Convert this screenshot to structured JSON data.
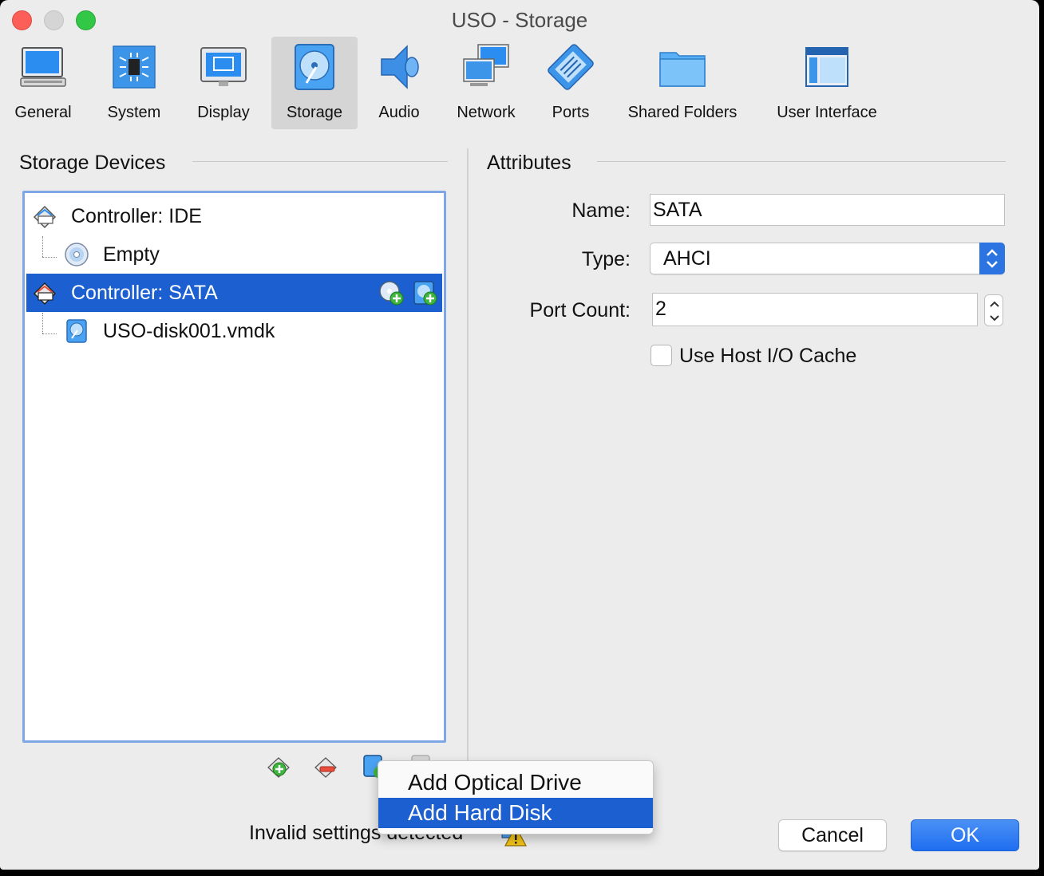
{
  "window": {
    "title": "USO - Storage"
  },
  "toolbar": {
    "items": [
      {
        "label": "General",
        "icon": "general-monitor-icon"
      },
      {
        "label": "System",
        "icon": "chip-icon"
      },
      {
        "label": "Display",
        "icon": "display-icon"
      },
      {
        "label": "Storage",
        "icon": "storage-disk-icon",
        "selected": true
      },
      {
        "label": "Audio",
        "icon": "speaker-icon"
      },
      {
        "label": "Network",
        "icon": "network-icon"
      },
      {
        "label": "Ports",
        "icon": "ports-icon"
      },
      {
        "label": "Shared Folders",
        "icon": "folder-icon"
      },
      {
        "label": "User Interface",
        "icon": "window-ui-icon"
      }
    ]
  },
  "storage": {
    "section_title": "Storage Devices",
    "tree": [
      {
        "label": "Controller: IDE",
        "kind": "controller"
      },
      {
        "label": "Empty",
        "kind": "optical"
      },
      {
        "label": "Controller: SATA",
        "kind": "controller",
        "selected": true
      },
      {
        "label": "USO-disk001.vmdk",
        "kind": "harddisk"
      }
    ]
  },
  "attributes": {
    "section_title": "Attributes",
    "name_label": "Name:",
    "name_value": "SATA",
    "type_label": "Type:",
    "type_value": "AHCI",
    "port_count_label": "Port Count:",
    "port_count_value": "2",
    "host_cache_label": "Use Host I/O Cache",
    "host_cache_checked": false
  },
  "context_menu": {
    "items": [
      {
        "label": "Add Optical Drive",
        "highlighted": false
      },
      {
        "label": "Add Hard Disk",
        "highlighted": true
      }
    ]
  },
  "status": {
    "text": "Invalid settings detected"
  },
  "buttons": {
    "cancel": "Cancel",
    "ok": "OK"
  },
  "colors": {
    "selection": "#1b5fd0",
    "accent": "#2d74e3",
    "close": "#fc5f57",
    "maximize": "#33c748"
  }
}
